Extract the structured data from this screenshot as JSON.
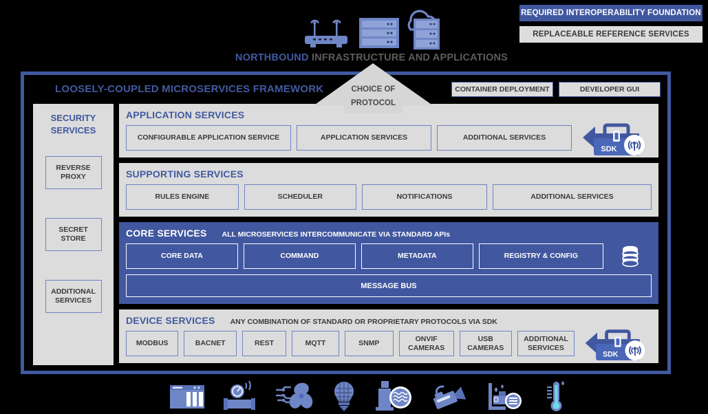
{
  "legend": {
    "required": "REQUIRED INTEROPERABILITY FOUNDATION",
    "replaceable": "REPLACEABLE REFERENCE SERVICES"
  },
  "northbound": {
    "emphasis": "NORTHBOUND",
    "rest": " INFRASTRUCTURE AND APPLICATIONS",
    "icons": [
      "router-icon",
      "server-rack-icon",
      "cloud-server-icon"
    ]
  },
  "protocol_arrow": {
    "line1": "CHOICE OF",
    "line2": "PROTOCOL"
  },
  "framework": {
    "title": "LOOSELY-COUPLED MICROSERVICES FRAMEWORK",
    "buttons": [
      "CONTAINER DEPLOYMENT",
      "DEVELOPER GUI"
    ]
  },
  "security": {
    "title_line1": "SECURITY",
    "title_line2": "SERVICES",
    "boxes": [
      "REVERSE PROXY",
      "SECRET STORE",
      "ADDITIONAL SERVICES"
    ]
  },
  "application_services": {
    "title": "APPLICATION SERVICES",
    "note": "",
    "cells": [
      "CONFIGURABLE APPLICATION SERVICE",
      "APPLICATION SERVICES",
      "ADDITIONAL SERVICES"
    ],
    "sdk_label": "SDK"
  },
  "supporting_services": {
    "title": "SUPPORTING SERVICES",
    "note": "",
    "cells": [
      "RULES ENGINE",
      "SCHEDULER",
      "NOTIFICATIONS",
      "ADDITIONAL SERVICES"
    ]
  },
  "core_services": {
    "title": "CORE SERVICES",
    "note": "ALL MICROSERVICES INTERCOMMUNICATE VIA STANDARD APIs",
    "cells": [
      "CORE DATA",
      "COMMAND",
      "METADATA",
      "REGISTRY & CONFIG"
    ],
    "message_bus": "MESSAGE BUS",
    "database_icon": "database-icon"
  },
  "device_services": {
    "title": "DEVICE SERVICES",
    "note": "ANY COMBINATION OF STANDARD OR PROPRIETARY PROTOCOLS VIA SDK",
    "cells": [
      "MODBUS",
      "BACNET",
      "REST",
      "MQTT",
      "SNMP",
      "ONVIF CAMERAS",
      "USB CAMERAS",
      "ADDITIONAL SERVICES"
    ],
    "sdk_label": "SDK"
  },
  "southbound_icons": [
    "industrial-panel-icon",
    "pipe-gauge-sensor-icon",
    "circuit-fan-icon",
    "light-bulb-icon",
    "machine-monitor-icon",
    "video-camera-icon",
    "pump-meter-icon",
    "thermometer-icon"
  ],
  "colors": {
    "brand_blue": "#41579f",
    "light_blue": "#6f82c2",
    "panel_gray": "#dcdcdc",
    "background": "#000000",
    "text_gray": "#3a3a3a",
    "icon_blue": "#6f86c6"
  }
}
